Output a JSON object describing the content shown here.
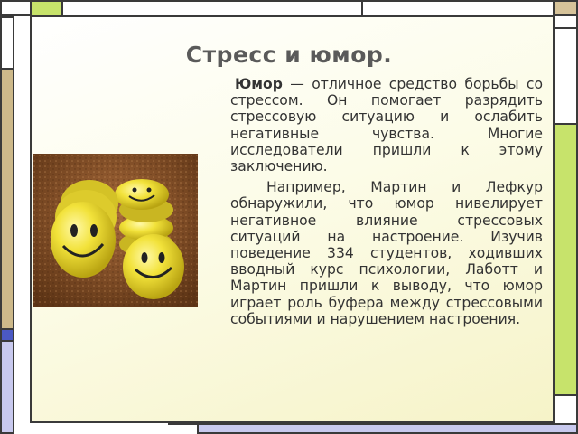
{
  "slide": {
    "title": "Стресс и юмор.",
    "paragraph1_term": "Юмор",
    "paragraph1_rest": " — отличное средство борьбы со стрессом. Он помогает разрядить стрессовую ситуацию и ослабить негативные чувства. Многие исследователи пришли к этому заключению.",
    "paragraph2": "Например, Мартин и Лефкур обнаружили, что юмор нивелирует негативное влияние стрессовых ситуаций на настроение. Изучив поведение 334 студентов, ходивших вводный курс психологии, Лаботт и Мартин пришли к выводу, что юмор играет роль буфера между стрессовыми событиями и нарушением настроения."
  },
  "image": {
    "icon": "smiley-faces-photo"
  },
  "colors": {
    "accent_green": "#c7e36b",
    "accent_tan": "#cdb98a",
    "accent_blue": "#4b59c4",
    "accent_lavender": "#c8c9ee",
    "smiley_yellow": "#f2e23a"
  }
}
